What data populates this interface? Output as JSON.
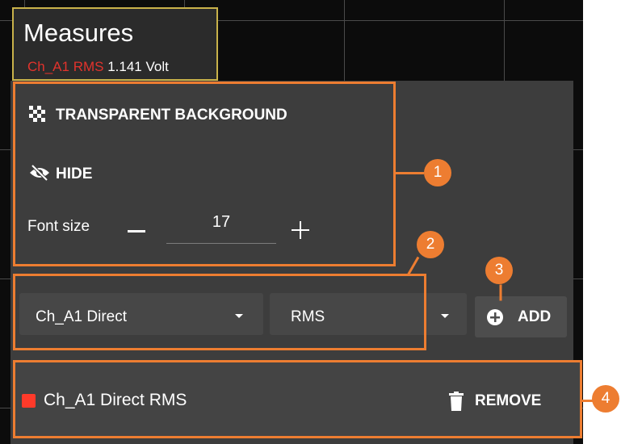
{
  "measures_overlay": {
    "title": "Measures",
    "measure_name": "Ch_A1 RMS",
    "measure_value": "1.141 Volt"
  },
  "settings": {
    "transparent_background_label": "TRANSPARENT BACKGROUND",
    "hide_label": "HIDE",
    "font_size_label": "Font size",
    "font_size_value": "17"
  },
  "add_measure": {
    "source_select_value": "Ch_A1 Direct",
    "type_select_value": "RMS",
    "add_label": "ADD"
  },
  "measure_list": [
    {
      "name": "Ch_A1 Direct RMS",
      "color": "#ff3a2a",
      "remove_label": "REMOVE"
    }
  ],
  "annotations": {
    "badge_1": "1",
    "badge_2": "2",
    "badge_3": "3",
    "badge_4": "4"
  },
  "colors": {
    "annotation": "#ed7d31",
    "panel": "#3d3d3d",
    "measure_red": "#e2332c"
  },
  "icons": {
    "transparent": "checkerboard-icon",
    "hide": "eye-off-icon",
    "add": "plus-circle-icon",
    "remove": "trash-icon"
  }
}
